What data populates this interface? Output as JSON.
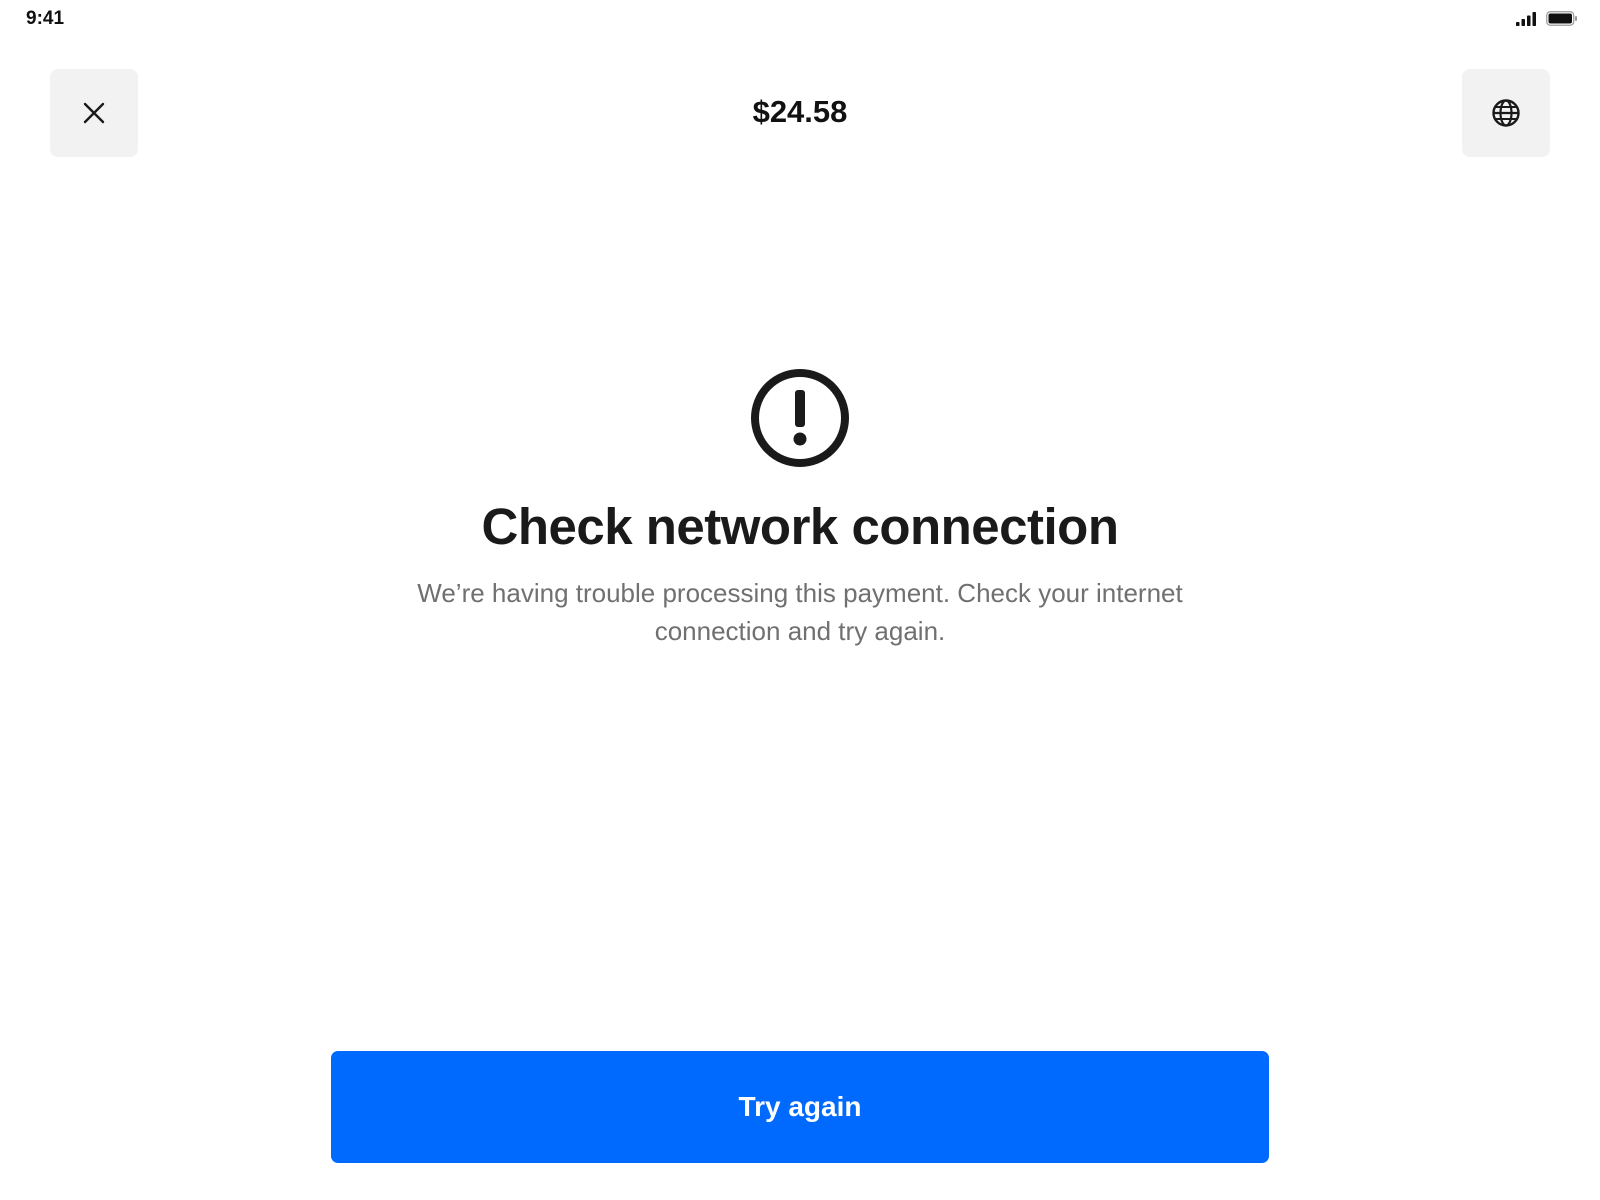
{
  "status_bar": {
    "time": "9:41",
    "signal_icon": "cellular-signal-icon",
    "battery_icon": "battery-icon"
  },
  "header": {
    "close_icon": "close-icon",
    "amount": "$24.58",
    "language_icon": "globe-icon"
  },
  "error": {
    "icon": "alert-circle-icon",
    "title": "Check network connection",
    "message": "We’re having trouble processing this payment. Check your internet connection and try again."
  },
  "actions": {
    "try_again_label": "Try again"
  },
  "colors": {
    "primary": "#006aff",
    "icon_button_bg": "#f2f2f2",
    "heading": "#1a1a1a",
    "body": "#707070"
  }
}
